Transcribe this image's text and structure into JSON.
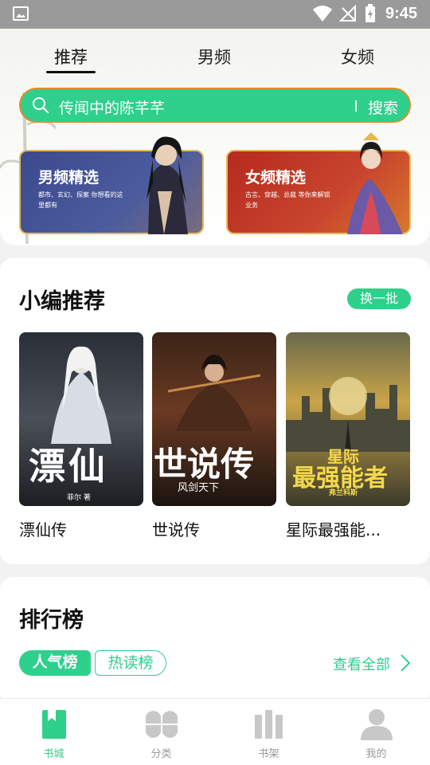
{
  "status_bar": {
    "time": "9:45"
  },
  "top_tabs": [
    {
      "label": "推荐",
      "active": true
    },
    {
      "label": "男频",
      "active": false
    },
    {
      "label": "女频",
      "active": false
    }
  ],
  "search": {
    "placeholder": "传闻中的陈芊芊",
    "button_label": "搜索"
  },
  "category_cards": {
    "male": {
      "title": "男频精选",
      "subtitle": "都市、玄幻、探案 你想看的这里都有"
    },
    "female": {
      "title": "女频精选",
      "subtitle": "古言、穿越、总裁 等你来解锁业务"
    }
  },
  "editor_picks": {
    "title": "小编推荐",
    "swap_label": "换一批",
    "books": [
      {
        "name": "漂仙传",
        "cover_title": "漂仙",
        "cover_author": "菲尔 著"
      },
      {
        "name": "世说传",
        "cover_title": "世说传",
        "cover_author": "风剑天下"
      },
      {
        "name": "星际最强能...",
        "cover_title": "最强能者",
        "cover_tag": "星际",
        "cover_author": "弗兰科斯"
      }
    ]
  },
  "ranking": {
    "title": "排行榜",
    "tabs": [
      {
        "label": "人气榜",
        "active": true
      },
      {
        "label": "热读榜",
        "active": false
      }
    ],
    "view_all_label": "查看全部"
  },
  "bottom_nav": [
    {
      "label": "书城",
      "icon": "bookstore-icon",
      "active": true
    },
    {
      "label": "分类",
      "icon": "category-icon",
      "active": false
    },
    {
      "label": "书架",
      "icon": "bookshelf-icon",
      "active": false
    },
    {
      "label": "我的",
      "icon": "profile-icon",
      "active": false
    }
  ],
  "colors": {
    "accent": "#2fcf8c",
    "search_border": "#e58a2b",
    "male_card": "#3c4a8c",
    "female_card": "#b52a1f"
  }
}
